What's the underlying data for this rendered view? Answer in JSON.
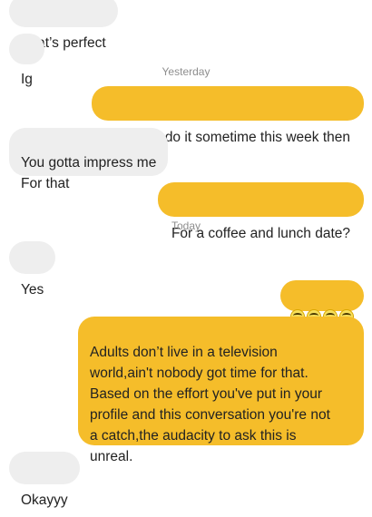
{
  "messages": [
    {
      "side": "incoming",
      "text": "That’s perfect"
    },
    {
      "side": "incoming",
      "text": "Ig"
    },
    {
      "side": "divider",
      "text": "Yesterday"
    },
    {
      "side": "outgoing",
      "text": "Well let's do it sometime this week then"
    },
    {
      "side": "incoming",
      "text": "You gotta impress me\nFor that"
    },
    {
      "side": "outgoing",
      "text": "For a coffee and lunch date?"
    },
    {
      "side": "divider",
      "text": "Today"
    },
    {
      "side": "incoming",
      "text": "Yes"
    },
    {
      "side": "outgoing",
      "emoji": "grinning-squinting-face",
      "count": 4
    },
    {
      "side": "outgoing",
      "text": "Adults don’t live in a television\nworld,ain't nobody got time for that.\nBased on the effort you've put in your\nprofile and this conversation you're not\na catch,the audacity to ask this is\nunreal."
    },
    {
      "side": "incoming",
      "text": "Okayyy"
    }
  ],
  "colors": {
    "incoming_bubble": "#eeeeee",
    "outgoing_bubble": "#f5bd2a",
    "text": "#222222",
    "divider_text": "#8e8e8e"
  }
}
